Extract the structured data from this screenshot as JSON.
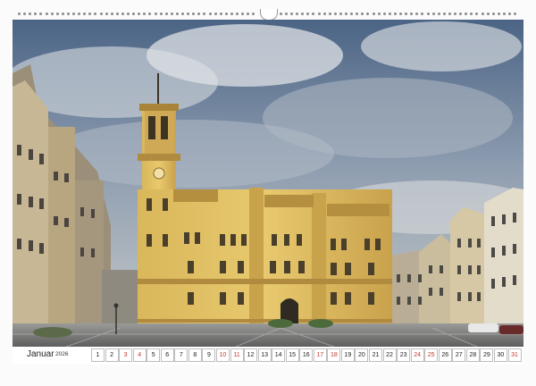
{
  "calendar": {
    "month": "Januar",
    "year": "2026",
    "weekend_color": "#c0392b",
    "days": [
      {
        "n": "1",
        "we": false
      },
      {
        "n": "2",
        "we": false
      },
      {
        "n": "3",
        "we": true
      },
      {
        "n": "4",
        "we": true
      },
      {
        "n": "5",
        "we": false
      },
      {
        "n": "6",
        "we": false
      },
      {
        "n": "7",
        "we": false
      },
      {
        "n": "8",
        "we": false
      },
      {
        "n": "9",
        "we": false
      },
      {
        "n": "10",
        "we": true
      },
      {
        "n": "11",
        "we": true
      },
      {
        "n": "12",
        "we": false
      },
      {
        "n": "13",
        "we": false
      },
      {
        "n": "14",
        "we": false
      },
      {
        "n": "15",
        "we": false
      },
      {
        "n": "16",
        "we": false
      },
      {
        "n": "17",
        "we": true
      },
      {
        "n": "18",
        "we": true
      },
      {
        "n": "19",
        "we": false
      },
      {
        "n": "20",
        "we": false
      },
      {
        "n": "21",
        "we": false
      },
      {
        "n": "22",
        "we": false
      },
      {
        "n": "23",
        "we": false
      },
      {
        "n": "24",
        "we": true
      },
      {
        "n": "25",
        "we": true
      },
      {
        "n": "26",
        "we": false
      },
      {
        "n": "27",
        "we": false
      },
      {
        "n": "28",
        "we": false
      },
      {
        "n": "29",
        "we": false
      },
      {
        "n": "30",
        "we": false
      },
      {
        "n": "31",
        "we": true
      }
    ]
  }
}
